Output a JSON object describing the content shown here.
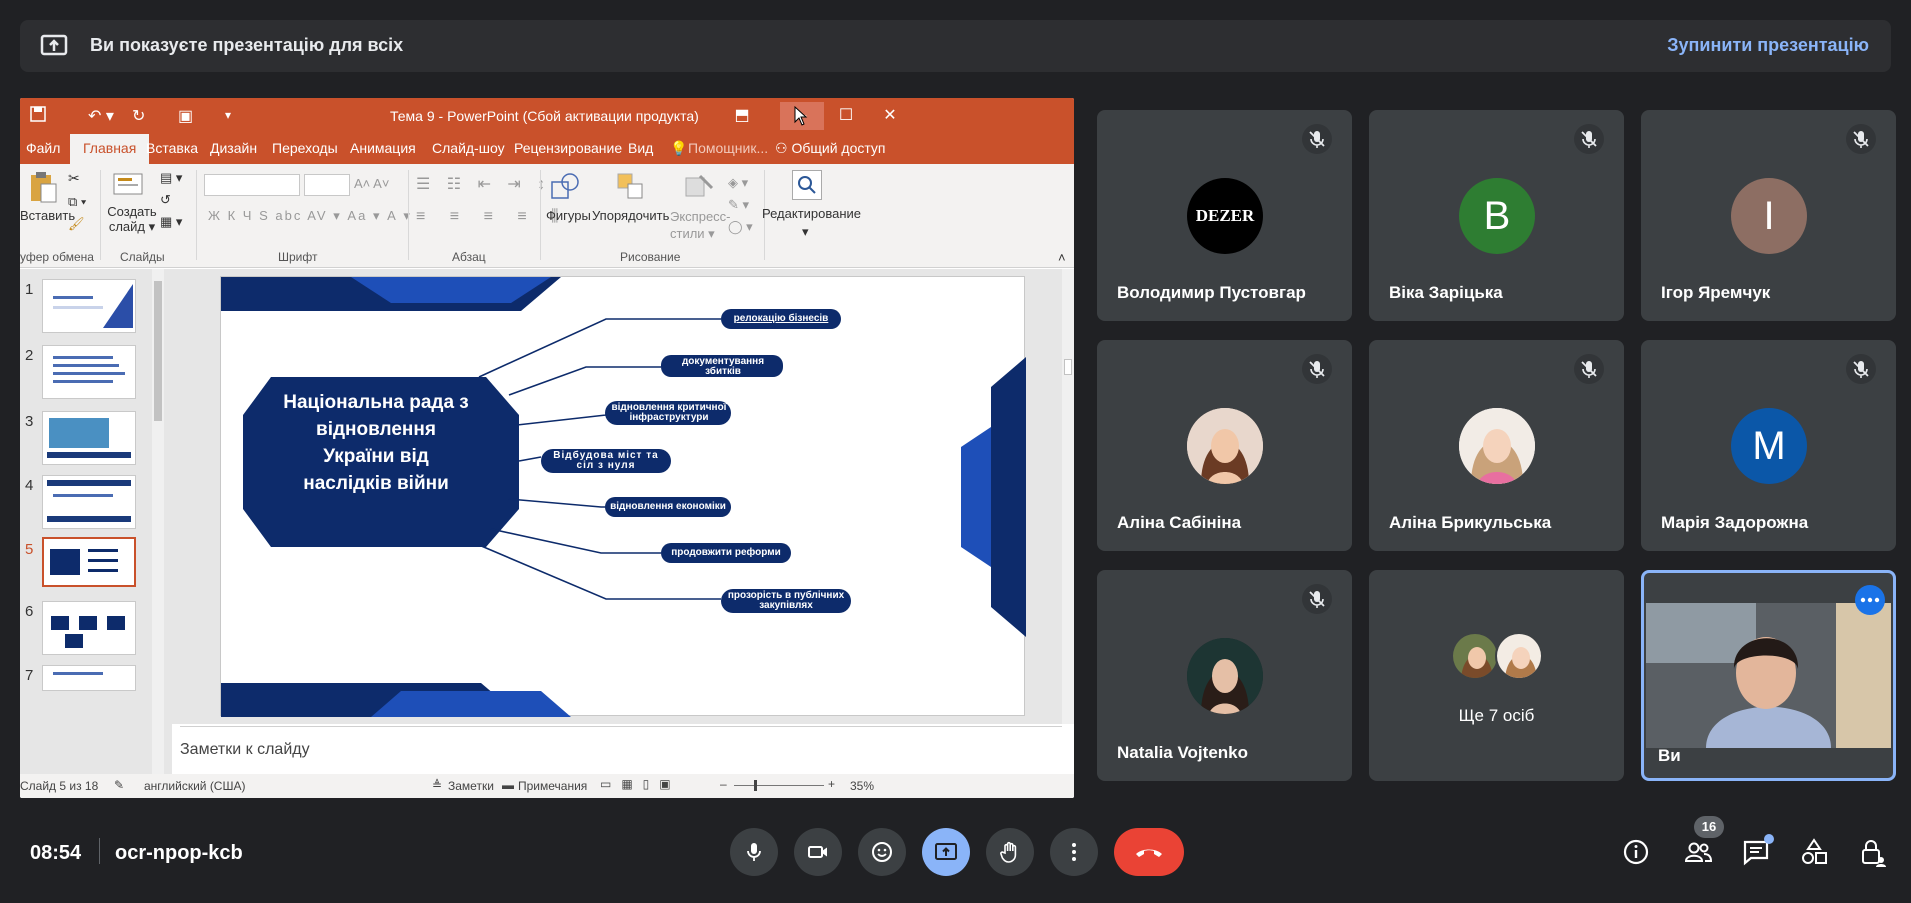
{
  "banner": {
    "message": "Ви показуєте презентацію для всіх",
    "stop_label": "Зупинити презентацію"
  },
  "ppt": {
    "title": "Тема 9  -  PowerPoint (Сбой активации продукта)",
    "tabs": [
      "Файл",
      "Главная",
      "Вставка",
      "Дизайн",
      "Переходы",
      "Анимация",
      "Слайд-шоу",
      "Рецензирование",
      "Вид"
    ],
    "active_tab": "Главная",
    "helper": "Помощник...",
    "share": "Общий доступ",
    "ribbon": {
      "paste": "Вставить",
      "new_slide": "Создать слайд ▾",
      "clipboard": "уфер обмена",
      "slides": "Слайды",
      "font": "Шрифт",
      "paragraph": "Абзац",
      "drawing": "Рисование",
      "shapes": "Фигуры",
      "arrange": "Упорядочить",
      "quick_styles": "Экспресс-стили ▾",
      "editing": "Редактирование",
      "font_buttons": "Ж  К  Ч  S  abc  AV ▾  Аа ▾  А ▾"
    },
    "thumb_numbers": [
      "1",
      "2",
      "3",
      "4",
      "5",
      "6",
      "7"
    ],
    "selected_slide": 5,
    "slide": {
      "main_text": "Національна рада з відновлення України від наслідків війни",
      "items": [
        "релокацію бізнесів",
        "документування збитків",
        "відновлення критичної інфраструктури",
        "Відбудова міст та сіл з нуля",
        "відновлення економіки",
        "продовжити реформи",
        "прозорість в публічних закупівлях"
      ]
    },
    "notes_placeholder": "Заметки к слайду",
    "status": {
      "slide": "Слайд 5 из 18",
      "language": "английский (США)",
      "notes": "Заметки",
      "comments": "Примечания",
      "zoom": "35%"
    }
  },
  "participants": [
    {
      "name": "Володимир Пустовгар",
      "avatar": "DEZER",
      "muted": true
    },
    {
      "name": "Віка Заріцька",
      "avatar": "В",
      "color": "#2e7d32",
      "muted": true
    },
    {
      "name": "Ігор Яремчук",
      "avatar": "І",
      "color": "#8d6e63",
      "muted": true
    },
    {
      "name": "Аліна Сабініна",
      "avatar": "photo",
      "muted": true
    },
    {
      "name": "Аліна Брикульська",
      "avatar": "photo",
      "muted": true
    },
    {
      "name": "Марія Задорожна",
      "avatar": "М",
      "color": "#0b57a8",
      "muted": true
    },
    {
      "name": "Natalia Vojtenko",
      "avatar": "photo",
      "muted": true
    },
    {
      "name": "Ще 7 осіб",
      "avatar": "group",
      "muted": false
    },
    {
      "name": "Ви",
      "avatar": "video",
      "muted": false
    }
  ],
  "bottom": {
    "time": "08:54",
    "meeting_code": "ocr-npop-kcb",
    "people_count": "16"
  },
  "colors": {
    "accent": "#8ab4f8",
    "end_call": "#ea4335",
    "present_active": "#8ab4f8",
    "slide_navy": "#0d2b6b"
  }
}
